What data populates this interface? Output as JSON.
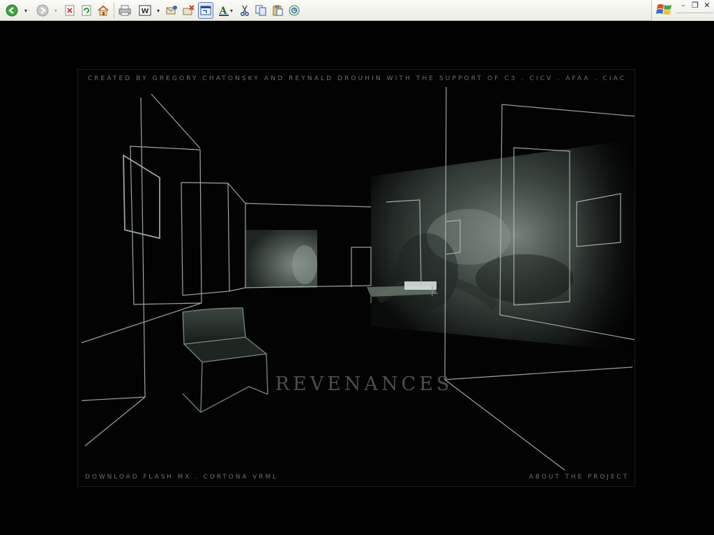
{
  "toolbar": {
    "buttons": [
      {
        "icon": "back-arrow-icon",
        "color": "#2e9a2e"
      },
      {
        "icon": "forward-arrow-icon",
        "color": "#9a9a9a"
      },
      {
        "icon": "stop-icon",
        "color": "#d23b2a"
      },
      {
        "icon": "refresh-icon",
        "color": "#2e9a2e"
      },
      {
        "icon": "home-icon",
        "color": "#d88a2a"
      },
      {
        "icon": "print-icon",
        "color": "#555555"
      },
      {
        "icon": "edit-word-icon",
        "color": "#333333"
      },
      {
        "icon": "mail-icon",
        "color": "#3a6db5"
      },
      {
        "icon": "delete-mail-icon",
        "color": "#d23b2a"
      },
      {
        "icon": "fullscreen-icon",
        "color": "#1f4f9a"
      },
      {
        "icon": "font-size-icon",
        "color": "#1f6f2a"
      },
      {
        "icon": "cut-icon",
        "color": "#2a4f8a"
      },
      {
        "icon": "copy-icon",
        "color": "#2a5fa0"
      },
      {
        "icon": "paste-icon",
        "color": "#a07a2a"
      },
      {
        "icon": "media-icon",
        "color": "#3a8a3a"
      }
    ]
  },
  "window_controls": {
    "minimize": "–",
    "restore": "❐",
    "close": "✕"
  },
  "stage": {
    "credits": "CREATED BY GREGORY CHATONSKY AND REYNALD DROUHIN WITH THE SUPPORT OF C3 . CICV . AFAA . CIAC",
    "title": "REVENANCES",
    "footer": {
      "download_prefix": "DOWNLOAD ",
      "flash_link": "FLASH MX",
      "separator": " . ",
      "vrml_link": "CORTONA VRML",
      "about_link": "ABOUT THE PROJECT"
    },
    "colors": {
      "wireframe": "#b8c2bb",
      "text": "#6f726d",
      "title": "#4b5149",
      "projection_tint": "#9fb1a6"
    }
  }
}
